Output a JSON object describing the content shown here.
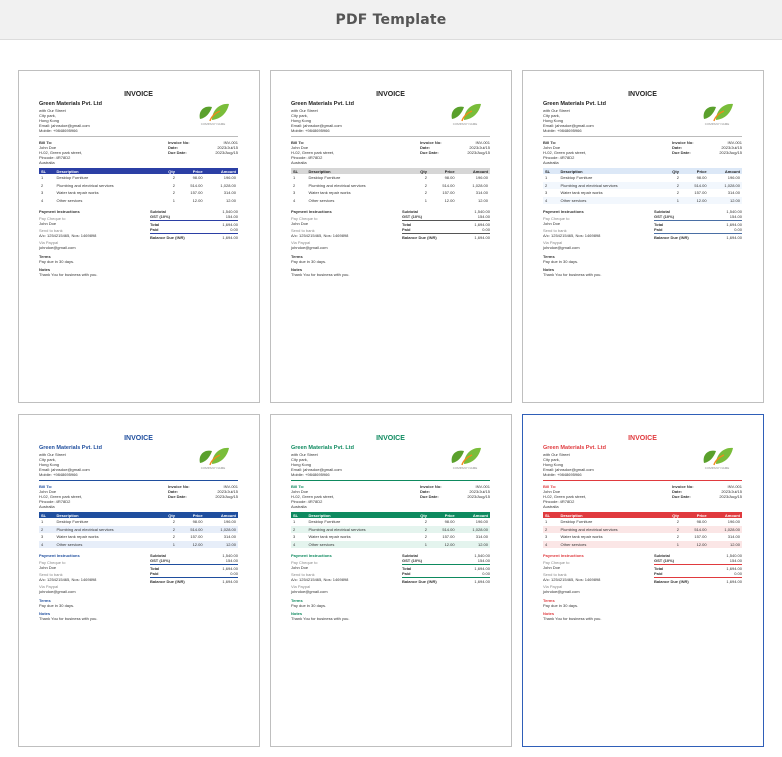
{
  "header": {
    "title": "PDF Template"
  },
  "invoice": {
    "title": "INVOICE",
    "company": "Green Materials Pvt. Ltd",
    "address": [
      "with Our Street",
      "City park,",
      "Hong Kong",
      "Email: jahnsdoe@gmail.com",
      "Mobile: +9848695966"
    ],
    "logo_caption": "COMPANY NAME",
    "bill_to_label": "Bill To:",
    "bill_to": [
      "John Doe",
      "H-02, Green park street,",
      "Pincode: 4R78D2",
      "Australia"
    ],
    "meta": [
      {
        "label": "Invoice No:",
        "value": "INV-001"
      },
      {
        "label": "Date:",
        "value": "2023/Jul/15"
      },
      {
        "label": "Due Date:",
        "value": "2023/Aug/15"
      }
    ],
    "columns": [
      "SL",
      "Description",
      "Qty",
      "Price",
      "Amount"
    ],
    "items": [
      {
        "sl": "1",
        "desc": "Desktop Furniture",
        "qty": "2",
        "price": "98.00",
        "amount": "196.00"
      },
      {
        "sl": "2",
        "desc": "Plumbing and electrical services",
        "qty": "2",
        "price": "514.00",
        "amount": "1,028.00"
      },
      {
        "sl": "3",
        "desc": "Water tank repair works",
        "qty": "2",
        "price": "157.00",
        "amount": "314.00"
      },
      {
        "sl": "4",
        "desc": "Other services",
        "qty": "1",
        "price": "12.00",
        "amount": "12.00"
      }
    ],
    "payment_heading": "Payment Instructions",
    "payment": [
      {
        "label": "Pay Cheque to",
        "value": "John Doe"
      },
      {
        "label": "Send to bank",
        "value": "A/c: 1254215465, Nos: 1469898"
      },
      {
        "label": "Via Paypal",
        "value": "johndoe@gmail.com"
      }
    ],
    "totals_top": [
      {
        "label": "Subtotal",
        "value": "1,540.00"
      },
      {
        "label": "GST (10%)",
        "value": "154.00"
      }
    ],
    "totals_bottom": [
      {
        "label": "Total",
        "value": "1,694.00"
      },
      {
        "label": "Paid",
        "value": "0.00"
      },
      {
        "label": "Balance Due (INR)",
        "value": "1,694.00"
      }
    ],
    "terms_heading": "Terms",
    "terms": "Pay due in 30 days.",
    "notes_heading": "Notes",
    "notes": "Thank You for business with you."
  },
  "templates": [
    {
      "id": "template-1",
      "accent": "#2b3fa5",
      "head_bg": "#2b3fa5",
      "head_fg": "#ffffff",
      "stripe": "#ffffff",
      "title_color": "#222222",
      "colored_headings": false,
      "selected": false
    },
    {
      "id": "template-2",
      "accent": "#555555",
      "head_bg": "#d6d6d6",
      "head_fg": "#222222",
      "stripe": "#ffffff",
      "title_color": "#222222",
      "colored_headings": false,
      "selected": false
    },
    {
      "id": "template-3",
      "accent": "#4a6fa5",
      "head_bg": "#dce8f7",
      "head_fg": "#222222",
      "stripe": "#f2f7fd",
      "title_color": "#222222",
      "colored_headings": false,
      "selected": false
    },
    {
      "id": "template-4",
      "accent": "#1f4e9e",
      "head_bg": "#1f4e9e",
      "head_fg": "#ffffff",
      "stripe": "#e7eef9",
      "title_color": "#1f4e9e",
      "colored_headings": true,
      "selected": false
    },
    {
      "id": "template-5",
      "accent": "#0e8a5f",
      "head_bg": "#0e8a5f",
      "head_fg": "#ffffff",
      "stripe": "#e4f4ee",
      "title_color": "#0e8a5f",
      "colored_headings": true,
      "selected": false
    },
    {
      "id": "template-6",
      "accent": "#e03a3e",
      "head_bg": "#e03a3e",
      "head_fg": "#ffffff",
      "stripe": "#fbe6e6",
      "title_color": "#e03a3e",
      "colored_headings": true,
      "selected": true
    }
  ]
}
